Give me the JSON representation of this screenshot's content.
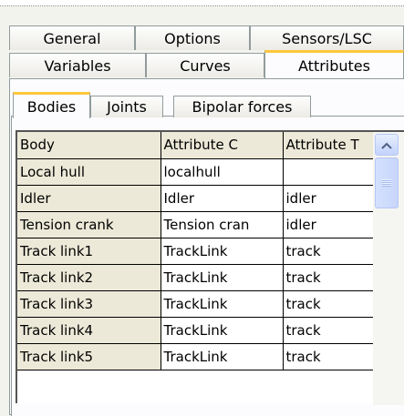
{
  "tabs_row1": [
    {
      "label": "General"
    },
    {
      "label": "Options"
    },
    {
      "label": "Sensors/LSC"
    }
  ],
  "tabs_row2": [
    {
      "label": "Variables"
    },
    {
      "label": "Curves"
    },
    {
      "label": "Attributes",
      "active": true
    }
  ],
  "subtabs": [
    {
      "label": "Bodies",
      "active": true
    },
    {
      "label": "Joints"
    },
    {
      "label": "Bipolar forces"
    }
  ],
  "grid": {
    "columns": [
      "Body",
      "Attribute C",
      "Attribute T"
    ],
    "rows": [
      [
        "Local hull",
        "localhull",
        ""
      ],
      [
        "Idler",
        "Idler",
        "idler"
      ],
      [
        "Tension crank",
        "Tension cran",
        "idler"
      ],
      [
        "Track link1",
        "TrackLink",
        "track"
      ],
      [
        "Track link2",
        "TrackLink",
        "track"
      ],
      [
        "Track link3",
        "TrackLink",
        "track"
      ],
      [
        "Track link4",
        "TrackLink",
        "track"
      ],
      [
        "Track link5",
        "TrackLink",
        "track"
      ]
    ]
  },
  "icons": {
    "scroll_up": "chevron-up-icon",
    "thumb_grip": "grip-icon"
  },
  "colors": {
    "active_tab_accent": "#ffc83c",
    "fixed_cell_bg": "#ece9d8",
    "scrollbar_blue": "#c3d3fd"
  }
}
